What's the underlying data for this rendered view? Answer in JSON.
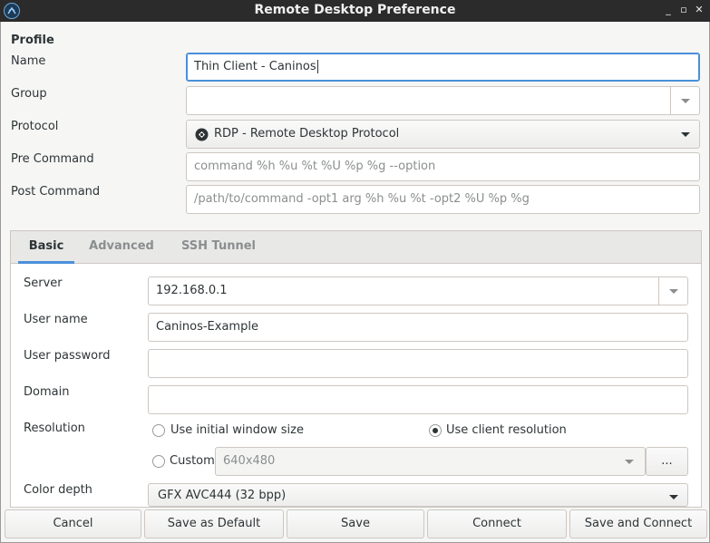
{
  "window": {
    "title": "Remote Desktop Preference"
  },
  "profile": {
    "section_title": "Profile",
    "name_label": "Name",
    "name_value": "Thin Client - Caninos",
    "group_label": "Group",
    "group_value": "",
    "protocol_label": "Protocol",
    "protocol_value": "RDP - Remote Desktop Protocol",
    "pre_command_label": "Pre Command",
    "pre_command_placeholder": "command %h %u %t %U %p %g --option",
    "post_command_label": "Post Command",
    "post_command_placeholder": "/path/to/command -opt1 arg %h %u %t -opt2 %U %p %g"
  },
  "tabs": [
    {
      "label": "Basic",
      "active": true
    },
    {
      "label": "Advanced",
      "active": false
    },
    {
      "label": "SSH Tunnel",
      "active": false
    }
  ],
  "basic": {
    "server_label": "Server",
    "server_value": "192.168.0.1",
    "username_label": "User name",
    "username_value": "Caninos-Example",
    "password_label": "User password",
    "password_value": "",
    "domain_label": "Domain",
    "domain_value": "",
    "resolution_label": "Resolution",
    "res_initial_label": "Use initial window size",
    "res_client_label": "Use client resolution",
    "res_custom_label": "Custom",
    "res_custom_value": "640x480",
    "res_more_label": "...",
    "color_depth_label": "Color depth",
    "color_depth_value": "GFX AVC444 (32 bpp)"
  },
  "actions": {
    "cancel": "Cancel",
    "save_default": "Save as Default",
    "save": "Save",
    "connect": "Connect",
    "save_connect": "Save and Connect"
  },
  "colors": {
    "accent": "#4a90d9",
    "titlebar": "#2b2b2b",
    "border": "#cdc7c2"
  }
}
